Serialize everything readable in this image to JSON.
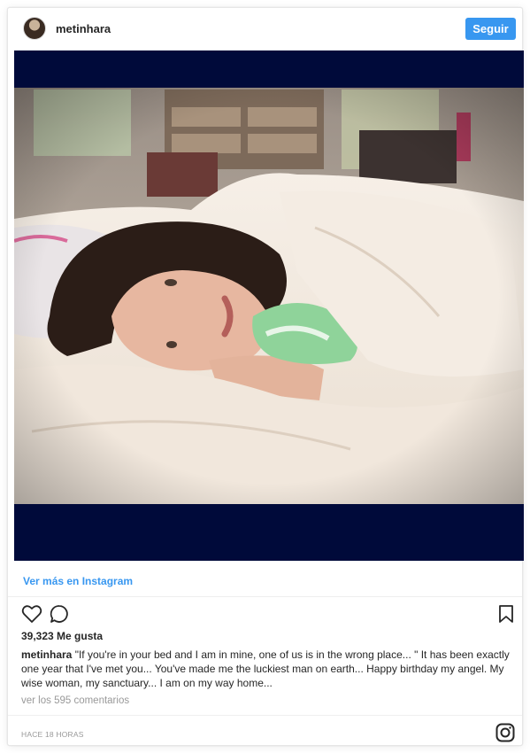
{
  "post": {
    "username": "metinhara",
    "follow_label": "Seguir",
    "view_more_label": "Ver más en Instagram",
    "likes_text": "39,323 Me gusta",
    "caption_user": "metinhara",
    "caption_text": " \"If you're in your bed and I am in mine, one of us is in the wrong place... \" It has been exactly one year that I've met you... You've made me the luckiest man on earth... Happy birthday my angel. My wise woman, my sanctuary... I am on my way home...",
    "comments_link": "ver los 595 comentarios",
    "timestamp": "HACE 18 HORAS"
  },
  "icons": {
    "like": "heart-icon",
    "comment": "comment-icon",
    "save": "bookmark-icon",
    "brand": "instagram-icon"
  },
  "colors": {
    "accent": "#3897f0",
    "text": "#262626",
    "muted": "#999999",
    "letterbox": "#000a3a"
  }
}
